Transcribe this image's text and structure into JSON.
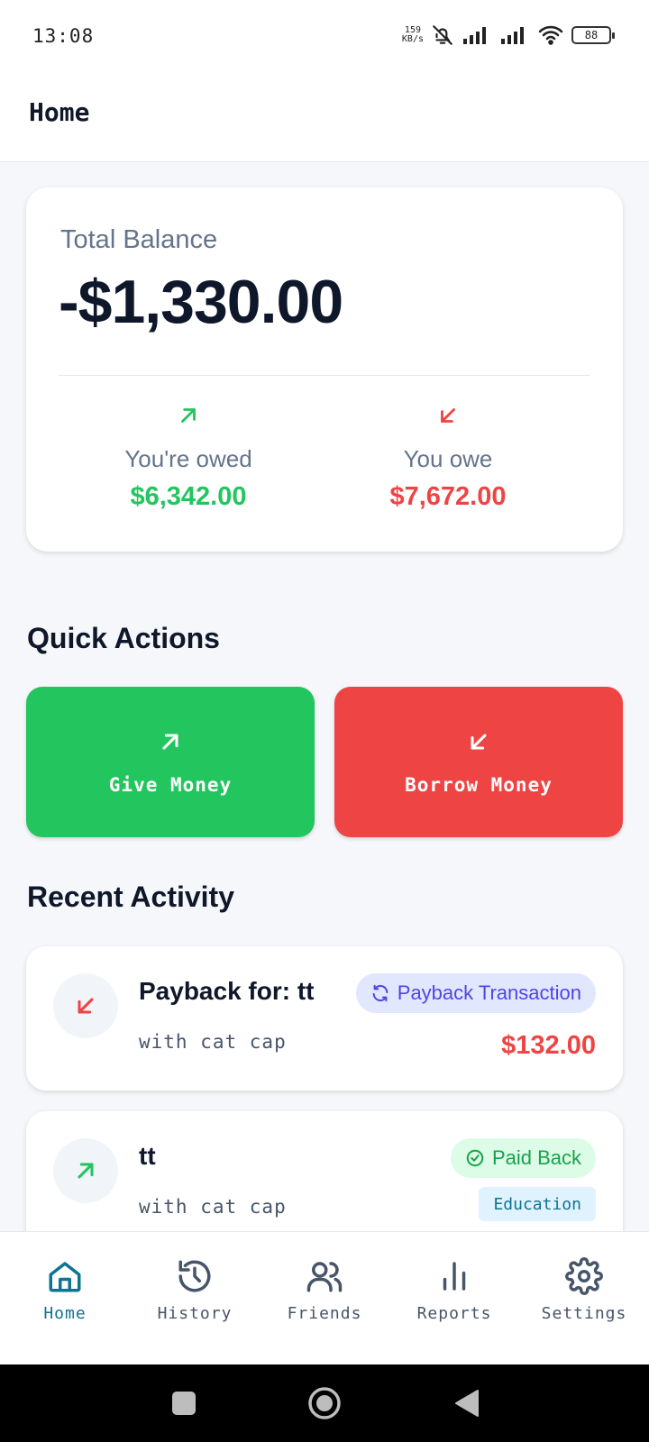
{
  "status_bar": {
    "time": "13:08",
    "net_speed_value": "159",
    "net_speed_unit": "KB/s",
    "battery": "88"
  },
  "header": {
    "title": "Home"
  },
  "balance": {
    "label": "Total Balance",
    "value": "-$1,330.00",
    "owed_label": "You're owed",
    "owed_amount": "$6,342.00",
    "owe_label": "You owe",
    "owe_amount": "$7,672.00"
  },
  "quick_actions": {
    "title": "Quick Actions",
    "give_label": "Give Money",
    "borrow_label": "Borrow Money"
  },
  "recent_activity": {
    "title": "Recent Activity",
    "items": [
      {
        "title": "Payback for: tt",
        "with": "with cat cap",
        "badge": "Payback Transaction",
        "amount": "$132.00"
      },
      {
        "title": "tt",
        "with": "with cat cap",
        "badge": "Paid Back",
        "category": "Education"
      }
    ]
  },
  "bottom_nav": {
    "items": [
      {
        "label": "Home",
        "icon": "home-icon",
        "active": true
      },
      {
        "label": "History",
        "icon": "history-icon",
        "active": false
      },
      {
        "label": "Friends",
        "icon": "friends-icon",
        "active": false
      },
      {
        "label": "Reports",
        "icon": "reports-icon",
        "active": false
      },
      {
        "label": "Settings",
        "icon": "settings-icon",
        "active": false
      }
    ]
  },
  "colors": {
    "positive": "#22c55e",
    "negative": "#ef4444",
    "accent": "#0e7490",
    "payback_badge": "#4f46e5"
  }
}
